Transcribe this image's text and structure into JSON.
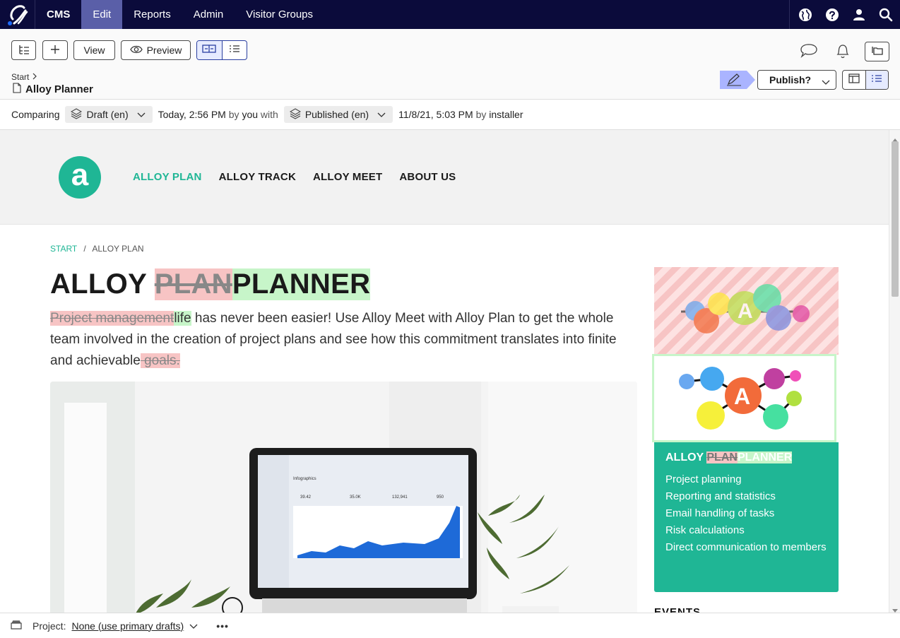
{
  "topnav": {
    "items": [
      {
        "label": "CMS"
      },
      {
        "label": "Edit"
      },
      {
        "label": "Reports"
      },
      {
        "label": "Admin"
      },
      {
        "label": "Visitor Groups"
      }
    ]
  },
  "toolbar": {
    "view_label": "View",
    "preview_label": "Preview",
    "breadcrumb_start": "Start",
    "page_title": "Alloy Planner",
    "publish_label": "Publish?"
  },
  "compare": {
    "label": "Comparing",
    "draft": "Draft (en)",
    "draft_time": "Today, 2:56 PM",
    "by1": "by",
    "who1": "you",
    "with": "with",
    "published": "Published (en)",
    "published_time": "11/8/21, 5:03 PM",
    "by2": "by",
    "who2": "installer"
  },
  "site": {
    "logo_letter": "a",
    "nav": [
      "ALLOY PLAN",
      "ALLOY TRACK",
      "ALLOY MEET",
      "ABOUT US"
    ],
    "crumb_start": "START",
    "crumb_sep": "/",
    "crumb_current": "ALLOY PLAN",
    "heading_prefix": "ALLOY ",
    "heading_removed": "PLAN",
    "heading_added": "PLANNER",
    "lead_removed1": "Project management",
    "lead_added1": "life",
    "lead_text": " has never been easier! Use Alloy Meet with Alloy Plan to get the whole team involved in the creation of project plans and see how this commitment translates into finite and achievable",
    "lead_removed2": " goals.",
    "screen_title": "Infographics",
    "screen_stats": [
      "39.42",
      "35.0K",
      "132,941",
      "950"
    ],
    "side_title_prefix": "ALLOY ",
    "side_title_removed": "PLAN",
    "side_title_added": "PLANNER",
    "side_items": [
      "Project planning",
      "Reporting and statistics",
      "Email handling of tasks",
      "Risk calculations",
      "Direct communication to members"
    ],
    "events_label": "EVENTS"
  },
  "bottom": {
    "project_label": "Project:",
    "project_value": "None (use primary drafts)",
    "more": "•••"
  },
  "colors": {
    "nav_bg": "#0b0b3b",
    "nav_active": "#5a5fa8",
    "brand_green": "#1fb695",
    "diff_removed": "#f7c4c4",
    "diff_added": "#c7f5c9"
  }
}
